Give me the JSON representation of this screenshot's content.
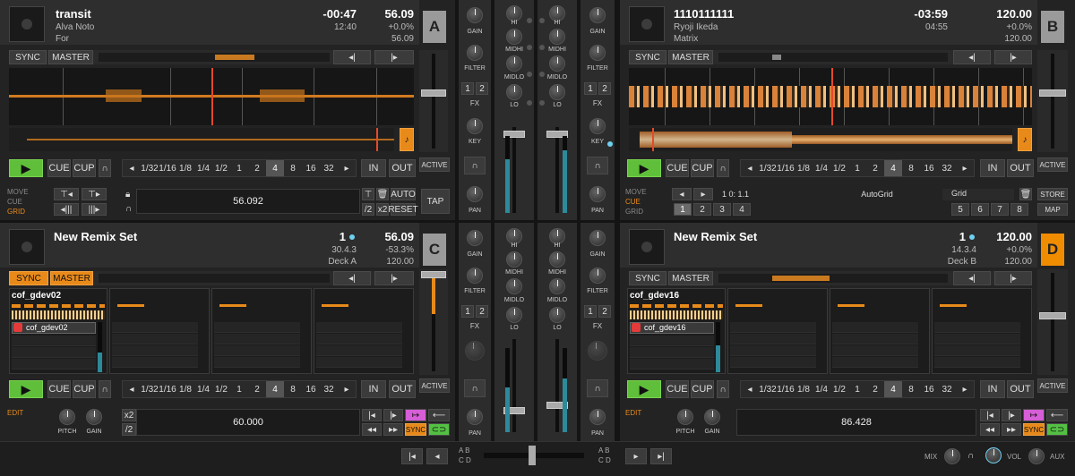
{
  "colors": {
    "accent": "#e88a1a",
    "play": "#5fbf3a",
    "cyan": "#6fd0f0",
    "panel": "#232323"
  },
  "loop_sizes": [
    "1/32",
    "1/16",
    "1/8",
    "1/4",
    "1/2",
    "1",
    "2",
    "4",
    "8",
    "16",
    "32"
  ],
  "deckA": {
    "title": "transit",
    "artist": "Alva Noto",
    "album": "For",
    "time_remaining": "-00:47",
    "time_total": "12:40",
    "bpm": "56.09",
    "pitch": "+0.0%",
    "tempo": "56.09",
    "letter": "A",
    "tempo_value": "56.092"
  },
  "deckB": {
    "title": "1110111111",
    "artist": "Ryoji Ikeda",
    "album": "Matrix",
    "time_remaining": "-03:59",
    "time_total": "04:55",
    "bpm": "120.00",
    "pitch": "+0.0%",
    "tempo": "120.00",
    "letter": "B",
    "grid_pos": "1 0: 1.1",
    "grid_mode": "AutoGrid",
    "grid_label": "Grid",
    "store": "STORE",
    "map": "MAP",
    "cues": [
      "1",
      "2",
      "3",
      "4",
      "5",
      "6",
      "7",
      "8"
    ]
  },
  "deckC": {
    "title": "New Remix Set",
    "beat": "1",
    "bpm": "56.09",
    "pos": "30.4.3",
    "pitch": "-53.3%",
    "source": "Deck A",
    "tempo": "120.00",
    "letter": "C",
    "slot_name": "cof_gdev02",
    "cell_name": "cof_gdev02",
    "value": "60.000"
  },
  "deckD": {
    "title": "New Remix Set",
    "beat": "1",
    "bpm": "120.00",
    "pos": "14.3.4",
    "pitch": "+0.0%",
    "source": "Deck B",
    "tempo": "120.00",
    "letter": "D",
    "slot_name": "cof_gdev16",
    "cell_name": "cof_gdev16",
    "value": "86.428"
  },
  "labels": {
    "sync": "SYNC",
    "master": "MASTER",
    "cue": "CUE",
    "cup": "CUP",
    "in": "IN",
    "out": "OUT",
    "active": "ACTIVE",
    "move": "MOVE",
    "cue_mode": "CUE",
    "grid": "GRID",
    "edit": "EDIT",
    "auto": "AUTO",
    "reset": "RESET",
    "tap": "TAP",
    "x2": "x2",
    "half": "/2",
    "pitch": "PITCH",
    "gain": "GAIN",
    "sync_small": "SYNC"
  },
  "mixer": {
    "gain": "GAIN",
    "hi": "HI",
    "midhi": "MIDHI",
    "midlo": "MIDLO",
    "lo": "LO",
    "filter": "FILTER",
    "fx": "FX",
    "key": "KEY",
    "pan": "PAN",
    "fx1": "1",
    "fx2": "2"
  },
  "footer": {
    "mix": "MIX",
    "vol": "VOL",
    "aux": "AUX",
    "xA": "A",
    "xB": "B",
    "xC": "C",
    "xD": "D"
  }
}
